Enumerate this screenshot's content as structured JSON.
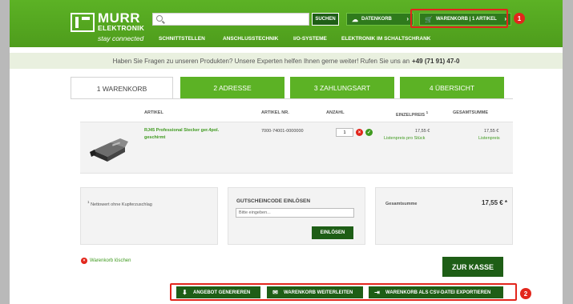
{
  "header": {
    "logo": {
      "brand_top": "MURR",
      "brand_bottom": "ELEKTRONIK",
      "tagline": "stay connected"
    },
    "search": {
      "placeholder": "",
      "button_label": "SUCHEN"
    },
    "datenkorb_label": "DATENKORB",
    "warenkorb_label": "WARENKORB | 1 ARTIKEL",
    "annotations": [
      "1",
      "2"
    ],
    "nav": [
      "SCHNITTSTELLEN",
      "ANSCHLUSSTECHNIK",
      "I/O-SYSTEME",
      "ELEKTRONIK IM SCHALTSCHRANK"
    ]
  },
  "infobar": {
    "text": "Haben Sie Fragen zu unseren Produkten? Unsere Experten helfen Ihnen gerne weiter! Rufen Sie uns an",
    "phone": "+49 (71 91) 47-0"
  },
  "tabs": [
    "1 WARENKORB",
    "2 ADRESSE",
    "3 ZAHLUNGSART",
    "4 ÜBERSICHT"
  ],
  "table": {
    "headers": {
      "artikel": "ARTIKEL",
      "artikel_nr": "ARTIKEL NR.",
      "anzahl": "ANZAHL",
      "einzelpreis": "EINZELPREIS",
      "einzelpreis_sup": "1",
      "gesamtsumme": "GESAMTSUMME"
    },
    "rows": [
      {
        "name_line1": "RJ45 Professional Stecker ger.4pol.",
        "name_line2": "geschirmt",
        "artikel_nr": "7000-74001-0000000",
        "qty": "1",
        "unit_price": "17,55 €",
        "unit_note": "Listenpreis pro Stück",
        "total": "17,55 €",
        "total_note": "Listenpreis"
      }
    ]
  },
  "footnote": {
    "sup": "1",
    "text": "Nettowert ohne Kupferzuschlag"
  },
  "coupon": {
    "title": "GUTSCHEINCODE EINLÖSEN",
    "placeholder": "Bitte eingeben...",
    "button": "EINLÖSEN"
  },
  "total": {
    "label": "Gesamtsumme",
    "value": "17,55 € *"
  },
  "delete_label": "Warenkorb löschen",
  "checkout_label": "ZUR KASSE",
  "actions": [
    "ANGEBOT GENERIEREN",
    "WARENKORB WEITERLEITEN",
    "WARENKORB ALS CSV-DATEI EXPORTIEREN"
  ],
  "colors": {
    "brand_green": "#5cb225",
    "dark_green": "#1e5e16",
    "annotation_red": "#e2261c"
  }
}
